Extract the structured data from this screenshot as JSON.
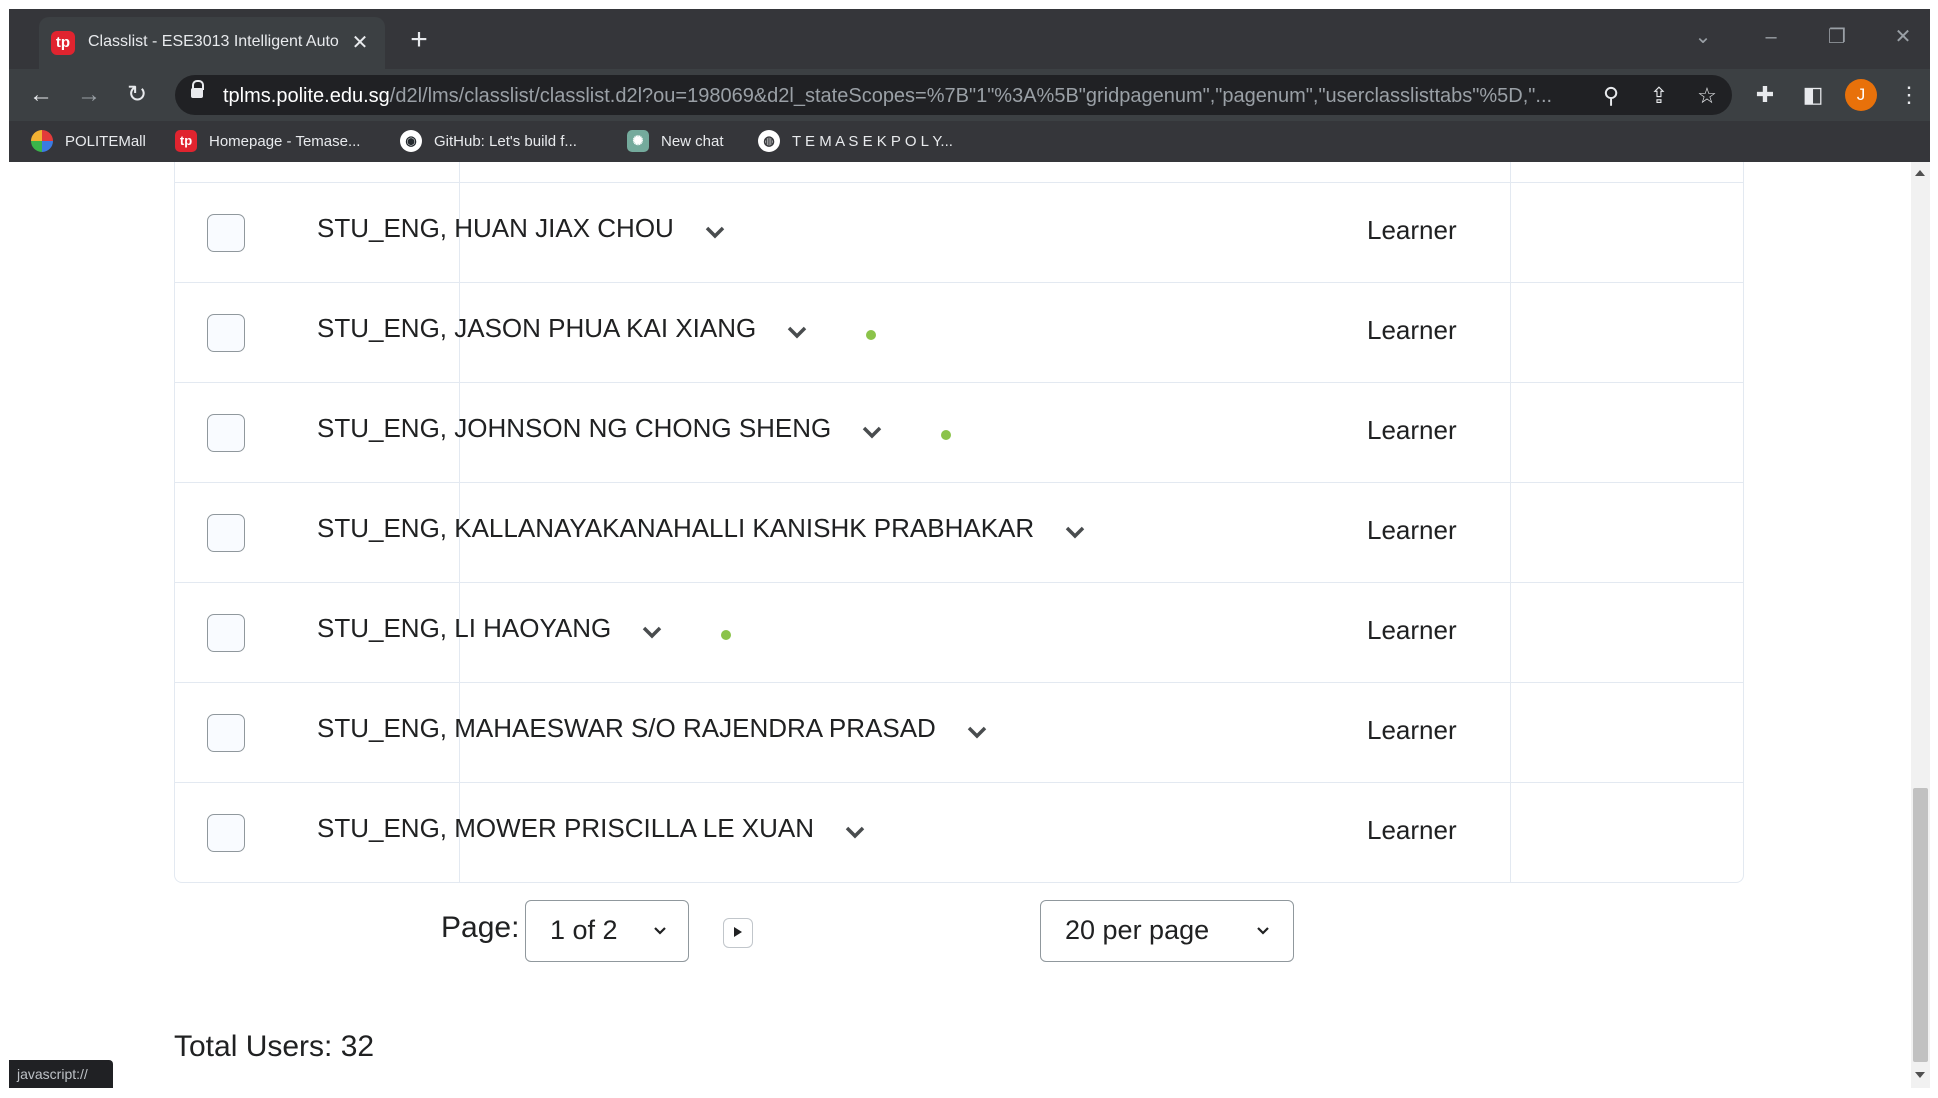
{
  "browser": {
    "tab": {
      "favicon_text": "tp",
      "title": "Classlist - ESE3013 Intelligent Auto",
      "close_glyph": "✕"
    },
    "new_tab_glyph": "+",
    "address": {
      "host": "tplms.polite.edu.sg",
      "path": "/d2l/lms/classlist/classlist.d2l?ou=198069&d2l_stateScopes=%7B\"1\"%3A%5B\"gridpagenum\",\"pagenum\",\"userclasslisttabs\"%5D,\"..."
    },
    "profile_initial": "J",
    "bookmarks": [
      {
        "label": "POLITEMall",
        "icon": "politemall-icon",
        "color": "#e23b3b"
      },
      {
        "label": "Homepage - Temase...",
        "icon": "tp-icon",
        "color": "#e0242f",
        "text": "tp"
      },
      {
        "label": "GitHub: Let's build f...",
        "icon": "github-icon",
        "color": "#ffffff"
      },
      {
        "label": "New chat",
        "icon": "chatgpt-icon",
        "color": "#74aa9c"
      },
      {
        "label": "T E M A S E K P O L Y...",
        "icon": "globe-icon",
        "color": "#ffffff"
      }
    ]
  },
  "classlist": {
    "rows": [
      {
        "name": "STU_ENG, HUAN JIAX CHOU",
        "role": "Learner",
        "online": false
      },
      {
        "name": "STU_ENG, JASON PHUA KAI XIANG",
        "role": "Learner",
        "online": true
      },
      {
        "name": "STU_ENG, JOHNSON NG CHONG SHENG",
        "role": "Learner",
        "online": true
      },
      {
        "name": "STU_ENG, KALLANAYAKANAHALLI KANISHK PRABHAKAR",
        "role": "Learner",
        "online": false
      },
      {
        "name": "STU_ENG, LI HAOYANG",
        "role": "Learner",
        "online": true
      },
      {
        "name": "STU_ENG, MAHAESWAR S/O RAJENDRA PRASAD",
        "role": "Learner",
        "online": false
      },
      {
        "name": "STU_ENG, MOWER PRISCILLA LE XUAN",
        "role": "Learner",
        "online": false
      }
    ],
    "online_color": "#8bc34a"
  },
  "pagination": {
    "page_label": "Page:",
    "page_value": "1 of 2",
    "per_page_value": "20 per page",
    "total_label": "Total Users: 32"
  },
  "status_bar": "javascript://"
}
